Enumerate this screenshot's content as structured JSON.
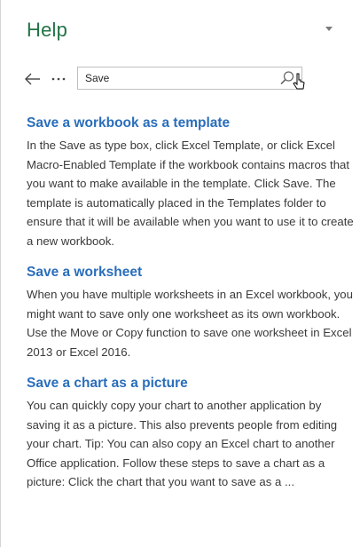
{
  "pane": {
    "title": "Help",
    "colors": {
      "title": "#217346",
      "link": "#2a6ebb",
      "text": "#3a3a3a",
      "border": "#bfbfbf"
    },
    "icons": {
      "menu": "triangle-down-icon",
      "back": "arrow-left-icon",
      "more": "ellipsis-icon",
      "search": "magnifier-icon",
      "cursor": "mouse-pointer-icon"
    }
  },
  "search": {
    "value": "Save"
  },
  "results": [
    {
      "title": "Save a workbook as a template",
      "snippet": "In the Save as type box, click Excel Template, or click Excel Macro-Enabled Template if the workbook contains macros that you want to make available in the template. Click Save. The template is automatically placed in the Templates folder to ensure that it will be available when you want to use it to create a new workbook."
    },
    {
      "title": "Save a worksheet",
      "snippet": "When you have multiple worksheets in an Excel workbook, you might want to save only one worksheet as its own workbook. Use the Move or Copy function to save one worksheet in Excel 2013 or Excel 2016."
    },
    {
      "title": "Save a chart as a picture",
      "snippet": "You can quickly copy your chart to another application by saving it as a picture. This also prevents people from editing your chart. Tip: You can also copy an Excel chart to another Office application. Follow these steps to save a chart as a picture: Click the chart that you want to save as a ..."
    }
  ]
}
